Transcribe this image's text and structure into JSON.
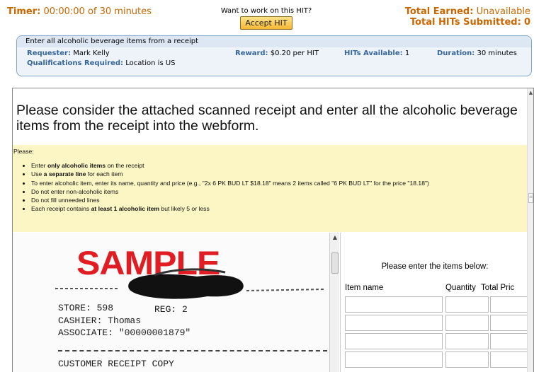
{
  "topbar": {
    "timer_label": "Timer:",
    "timer_value": "00:00:00 of 30 minutes",
    "want_text": "Want to work on this HIT?",
    "accept_label": "Accept HIT",
    "earned_label": "Total Earned:",
    "earned_value": "Unavailable",
    "submitted_label": "Total HITs Submitted:",
    "submitted_value": "0"
  },
  "hit": {
    "title": "Enter all alcoholic beverage items from a receipt",
    "requester_label": "Requester:",
    "requester_value": "Mark Kelly",
    "reward_label": "Reward:",
    "reward_value": "$0.20 per HIT",
    "available_label": "HITs Available:",
    "available_value": "1",
    "duration_label": "Duration:",
    "duration_value": "30 minutes",
    "quals_label": "Qualifications Required:",
    "quals_value": "Location is US"
  },
  "task": {
    "heading": "Please consider the attached scanned receipt and enter all the alcoholic beverage items from the receipt into the webform.",
    "please": "Please:",
    "bullets": [
      {
        "pre": "Enter ",
        "bold": "only alcoholic items",
        "post": " on the receipt"
      },
      {
        "pre": "Use ",
        "bold": "a separate line",
        "post": " for each item"
      },
      {
        "pre": "To enter alcoholic item, enter its name, quantity and price (e.g., \"2x 6 PK BUD LT $18.18\" means 2 items called \"6 PK BUD LT\" for the price \"18.18\")",
        "bold": "",
        "post": ""
      },
      {
        "pre": "Do not enter non-alcoholic items",
        "bold": "",
        "post": ""
      },
      {
        "pre": "Do not fill unneeded lines",
        "bold": "",
        "post": ""
      },
      {
        "pre": "Each receipt contains ",
        "bold": "at least 1 alcoholic item",
        "post": " but likely 5 or less"
      }
    ]
  },
  "receipt": {
    "watermark": "SAMPLE",
    "store": "STORE: 598",
    "reg": "REG: 2",
    "cashier": "CASHIER: Thomas",
    "associate": "ASSOCIATE: \"00000001879\"",
    "customer": "CUSTOMER RECEIPT COPY"
  },
  "form": {
    "prompt": "Please enter the items below:",
    "col_item": "Item name",
    "col_qty": "Quantity",
    "col_price": "Total Pric"
  },
  "colors": {
    "accent_orange": "#cc6600",
    "label_blue": "#35659c",
    "instructions_bg": "#fbf6c4",
    "watermark_red": "#e11c22"
  }
}
